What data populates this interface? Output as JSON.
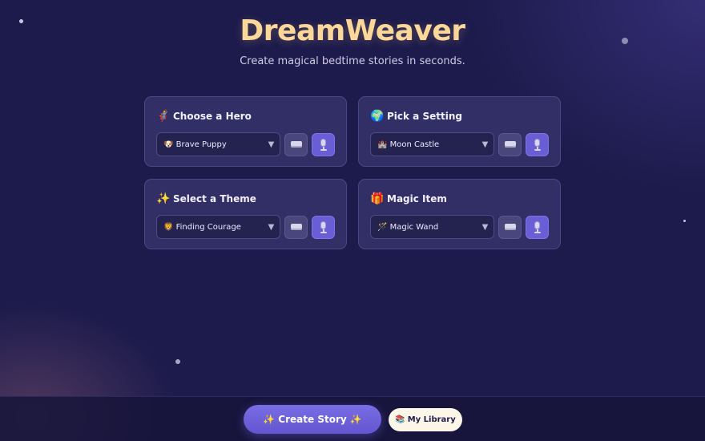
{
  "app": {
    "title": "DreamWeaver",
    "subtitle": "Create magical bedtime stories in seconds."
  },
  "cards": [
    {
      "emoji": "🦸",
      "title": "Choose a Hero",
      "selected": "🐶 Brave Puppy"
    },
    {
      "emoji": "🌍",
      "title": "Pick a Setting",
      "selected": "🏰 Moon Castle"
    },
    {
      "emoji": "✨",
      "title": "Select a Theme",
      "selected": "🦁 Finding Courage"
    },
    {
      "emoji": "🎁",
      "title": "Magic Item",
      "selected": "🪄 Magic Wand"
    }
  ],
  "icons": {
    "dropdown": "chevron-down-icon",
    "keyboard": "keyboard-icon",
    "microphone": "microphone-icon"
  },
  "footer": {
    "create_label": "✨ Create Story ✨",
    "library_icon": "📚",
    "library_label": "My Library"
  },
  "colors": {
    "background": "#1d1b4c",
    "title": "#fcd79a",
    "card": "#312f66",
    "accent": "#6a5ed6",
    "library_button": "#fbf6e8"
  }
}
